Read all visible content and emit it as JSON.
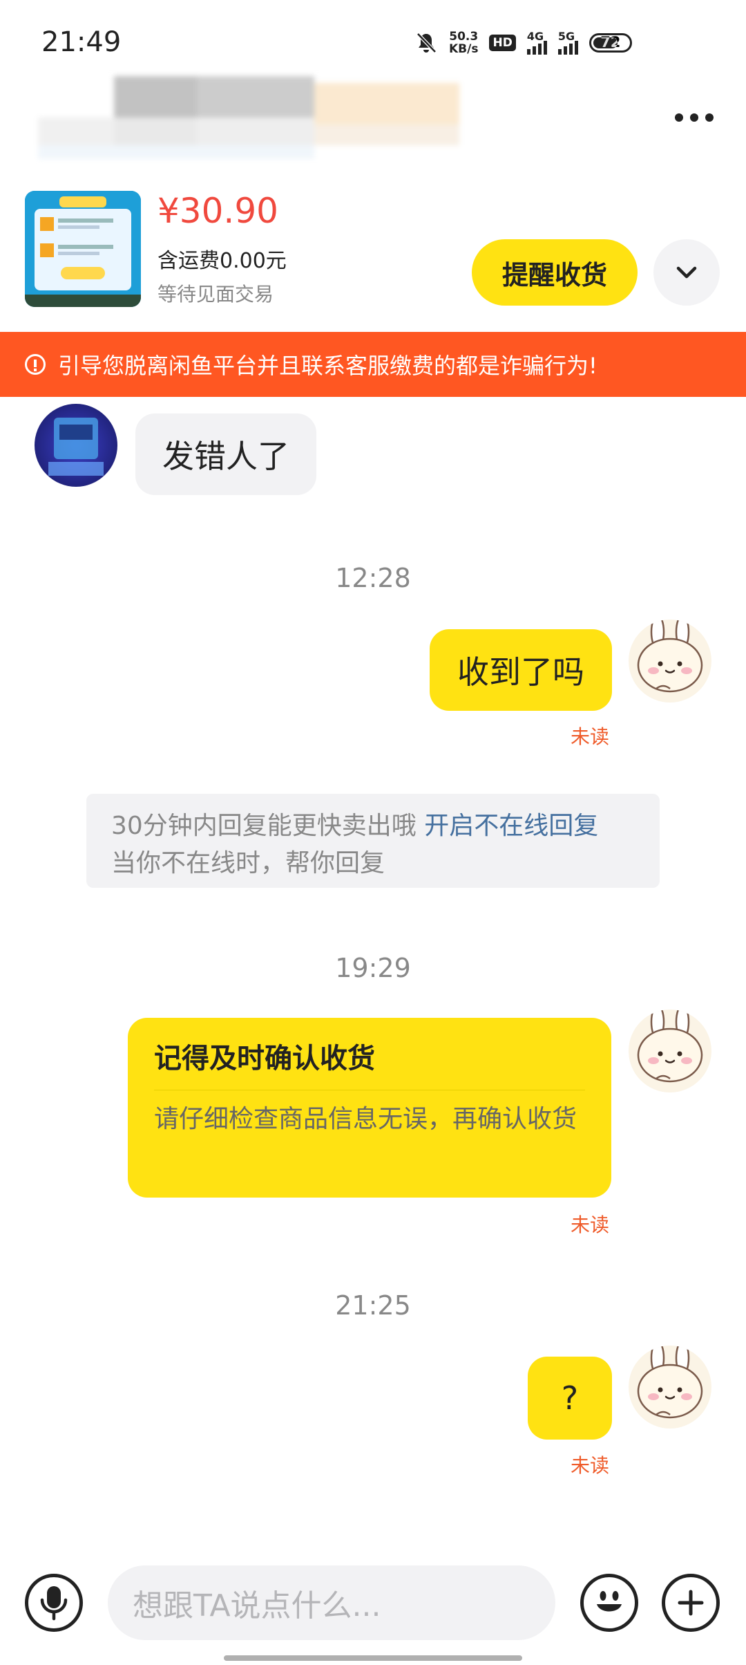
{
  "status_bar": {
    "time": "21:49",
    "net_speed_value": "50.3",
    "net_speed_unit": "KB/s",
    "hd_label": "HD",
    "net_4g": "4G",
    "net_5g": "5G",
    "battery": "72"
  },
  "product": {
    "price": "¥30.90",
    "shipping": "含运费0.00元",
    "status": "等待见面交易",
    "remind_label": "提醒收货"
  },
  "warning": {
    "text": "引导您脱离闲鱼平台并且联系客服缴费的都是诈骗行为!"
  },
  "messages": {
    "incoming_1": "发错人了",
    "time_1": "12:28",
    "outgoing_1": "收到了吗",
    "unread_label": "未读",
    "tip_text": "30分钟内回复能更快卖出哦",
    "tip_link": "开启不在线回复",
    "tip_sub": "当你不在线时，帮你回复",
    "time_2": "19:29",
    "card_title": "记得及时确认收货",
    "card_body": "请仔细检查商品信息无误，再确认收货",
    "time_3": "21:25",
    "outgoing_2": "?"
  },
  "input": {
    "placeholder": "想跟TA说点什么..."
  },
  "colors": {
    "accent_yellow": "#ffe212",
    "warning_orange": "#ff5722",
    "price_red": "#f0493e",
    "unread_orange": "#ef5b2a",
    "link_blue": "#45709f"
  },
  "icons": [
    "mute-icon",
    "more-icon",
    "chevron-down-icon",
    "alert-circle-icon",
    "mic-icon",
    "emoji-icon",
    "plus-icon"
  ]
}
